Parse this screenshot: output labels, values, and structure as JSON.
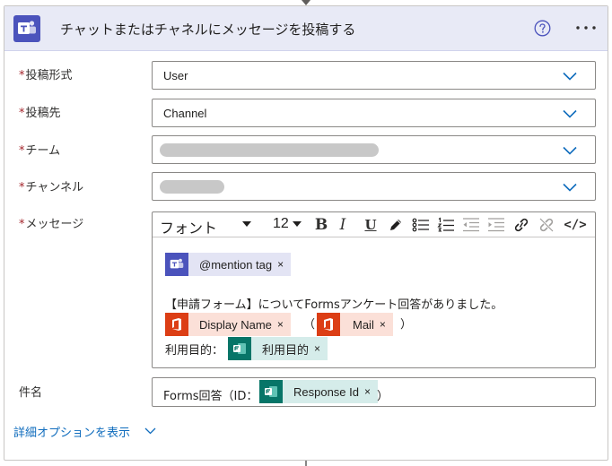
{
  "action": {
    "title": "チャットまたはチャネルにメッセージを投稿する"
  },
  "fields": {
    "post_as": {
      "label": "投稿形式",
      "value": "User"
    },
    "post_in": {
      "label": "投稿先",
      "value": "Channel"
    },
    "team": {
      "label": "チーム"
    },
    "channel": {
      "label": "チャンネル"
    },
    "message": {
      "label": "メッセージ"
    },
    "subject": {
      "label": "件名"
    }
  },
  "required_mark": "*",
  "toolbar": {
    "font": "フォント",
    "size": "12",
    "bold": "B",
    "italic": "I",
    "underline": "U",
    "code": "</>"
  },
  "message_body": {
    "mention_token": "@mention tag",
    "line1": "【申請フォーム】についてFormsアンケート回答がありました。",
    "display_name_token": "Display Name",
    "paren_open": "（",
    "mail_token": "Mail",
    "paren_close": "）",
    "purpose_label": "利用目的：",
    "purpose_token": "利用目的",
    "remove": "×"
  },
  "subject_body": {
    "prefix": "Forms回答（ID：",
    "response_token": "Response Id",
    "suffix": "）",
    "remove": "×"
  },
  "advanced_options": "詳細オプションを表示",
  "colors": {
    "teams": "#4b53bc",
    "office": "#dc3e15",
    "forms": "#077568",
    "link": "#0f6cbd",
    "required": "#a4262c"
  }
}
